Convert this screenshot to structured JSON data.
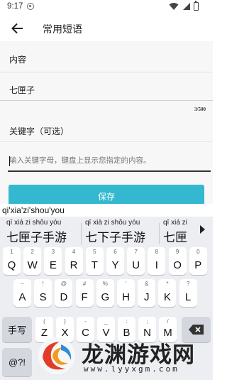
{
  "status_bar": {
    "time": "9:17"
  },
  "app_bar": {
    "title": "常用短语"
  },
  "form": {
    "content_label": "内容",
    "content_value": "七匣子",
    "counter": "3/500",
    "keyword_label": "关键字（可选）",
    "keyword_placeholder": "输入关键字母，键盘上显示您指定的内容。",
    "save_label": "保存"
  },
  "keyboard": {
    "composition": "qi'xia'zi'shou'you",
    "candidates": [
      {
        "pinyin": "qī xiá zi shǒu yóu",
        "hanzi": "七匣子手游"
      },
      {
        "pinyin": "qī xià zi shǒu yóu",
        "hanzi": "七下子手游"
      },
      {
        "pinyin": "qī xiá zi",
        "hanzi": "七匣"
      }
    ],
    "row1": [
      {
        "main": "Q",
        "sub": "1"
      },
      {
        "main": "W",
        "sub": "2"
      },
      {
        "main": "E",
        "sub": "3"
      },
      {
        "main": "R",
        "sub": "4"
      },
      {
        "main": "T",
        "sub": "5"
      },
      {
        "main": "Y",
        "sub": "6"
      },
      {
        "main": "U",
        "sub": "7"
      },
      {
        "main": "I",
        "sub": "8"
      },
      {
        "main": "O",
        "sub": "9"
      },
      {
        "main": "P",
        "sub": "0"
      }
    ],
    "row2": [
      {
        "main": "A",
        "sub": "~"
      },
      {
        "main": "S",
        "sub": "!"
      },
      {
        "main": "D",
        "sub": "@"
      },
      {
        "main": "F",
        "sub": "#"
      },
      {
        "main": "G",
        "sub": "%"
      },
      {
        "main": "H",
        "sub": "'"
      },
      {
        "main": "J",
        "sub": "&"
      },
      {
        "main": "K",
        "sub": "*"
      },
      {
        "main": "L",
        "sub": "?"
      }
    ],
    "row3": [
      {
        "main": "Z",
        "sub": "("
      },
      {
        "main": "X",
        "sub": ")"
      },
      {
        "main": "C",
        "sub": "-"
      },
      {
        "main": "V",
        "sub": "_"
      },
      {
        "main": "B",
        "sub": ":"
      },
      {
        "main": "N",
        "sub": ";"
      },
      {
        "main": "M",
        "sub": "/"
      }
    ],
    "handwrite_label": "手写",
    "symbols_label": "@?!"
  },
  "watermark": {
    "text": "龙渊游戏网",
    "url": "www.lyyxgm.com"
  },
  "colors": {
    "accent": "#34b8d0",
    "keyboard_bg": "#eceef2"
  }
}
